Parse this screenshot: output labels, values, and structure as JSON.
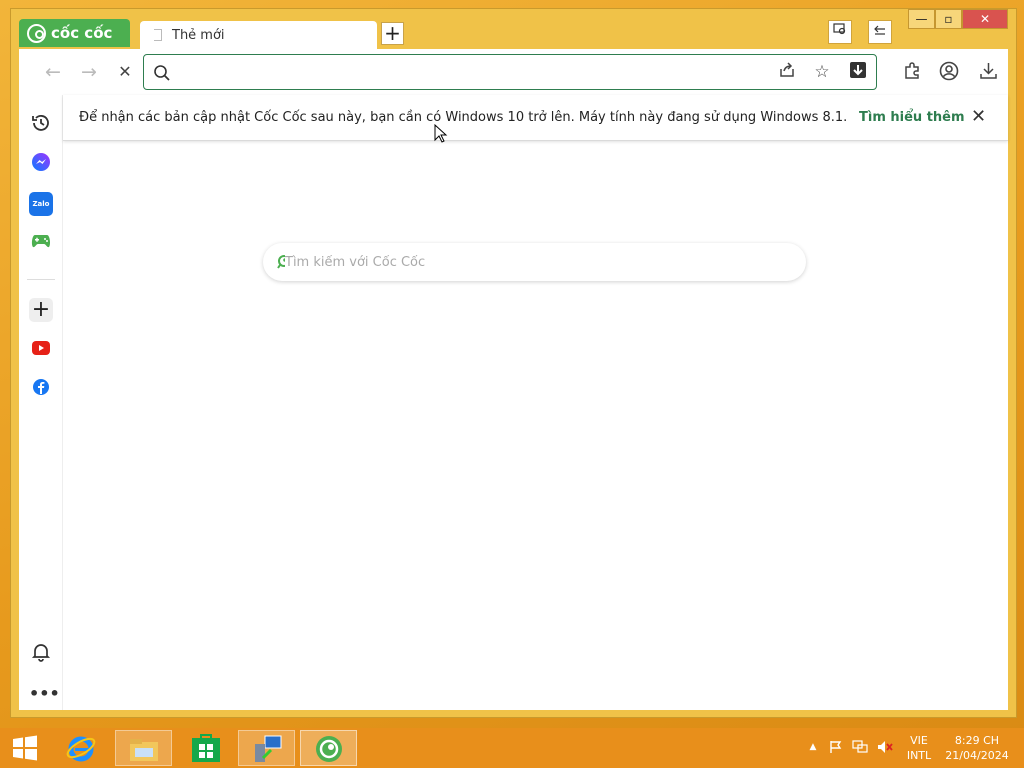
{
  "browser": {
    "brand": "cốc cốc",
    "tab": {
      "title": "Thẻ mới"
    },
    "new_tab_label": "+",
    "window_controls": {
      "minimize": "—",
      "maximize": "▫",
      "close": "✕"
    }
  },
  "toolbar": {
    "address_value": "",
    "icons": [
      "back-icon",
      "forward-icon",
      "stop-icon",
      "search-icon",
      "share-icon",
      "star-icon",
      "download-page-icon",
      "extensions-icon",
      "profile-icon",
      "downloads-icon"
    ]
  },
  "infobar": {
    "message": "Để nhận các bản cập nhật Cốc Cốc sau này, bạn cần có Windows 10 trở lên. Máy tính này đang sử dụng Windows 8.1.",
    "link": "Tìm hiểu thêm"
  },
  "newtab": {
    "search_placeholder": "Tìm kiếm với Cốc Cốc"
  },
  "sidebar": {
    "items": [
      "history-icon",
      "messenger-icon",
      "zalo-icon",
      "game-icon",
      "add-icon",
      "youtube-icon",
      "facebook-icon",
      "bell-icon",
      "more-icon"
    ],
    "zalo_label": "Zalo"
  },
  "taskbar": {
    "apps": [
      "windows-start-icon",
      "internet-explorer-icon",
      "file-explorer-icon",
      "store-icon",
      "network-wizard-icon",
      "coccoc-icon"
    ],
    "language": "VIE",
    "layout": "INTL",
    "time": "8:29 CH",
    "date": "21/04/2024"
  },
  "colors": {
    "brand_green": "#4caf50",
    "link_green": "#2e7d4f",
    "taskbar": "#e88f1b",
    "frame": "#f0c248"
  }
}
